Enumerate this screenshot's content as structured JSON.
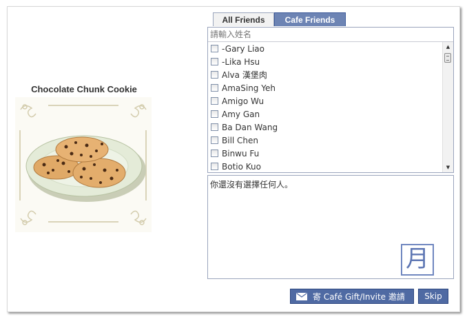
{
  "gift": {
    "title": "Chocolate Chunk Cookie",
    "image_icon": "chocolate-chunk-cookie-plate"
  },
  "tabs": [
    {
      "label": "All Friends",
      "selected": false
    },
    {
      "label": "Cafe Friends",
      "selected": true
    }
  ],
  "search": {
    "placeholder": "請輸入姓名"
  },
  "friends": [
    "-Gary Liao",
    "-Lika Hsu",
    "Alva 漢堡肉",
    "AmaSing Yeh",
    "Amigo Wu",
    "Amy Gan",
    "Ba Dan Wang",
    "Bill Chen",
    "Binwu Fu",
    "Botio Kuo"
  ],
  "selected_message": "你還沒有選擇任何人。",
  "badge": {
    "glyph": "月"
  },
  "buttons": {
    "send_label": "寄 Café Gift/Invite 邀請",
    "skip_label": "Skip"
  },
  "colors": {
    "accent": "#4f6aa3",
    "tab_active": "#6d84b4",
    "border": "#9aa4bc"
  }
}
